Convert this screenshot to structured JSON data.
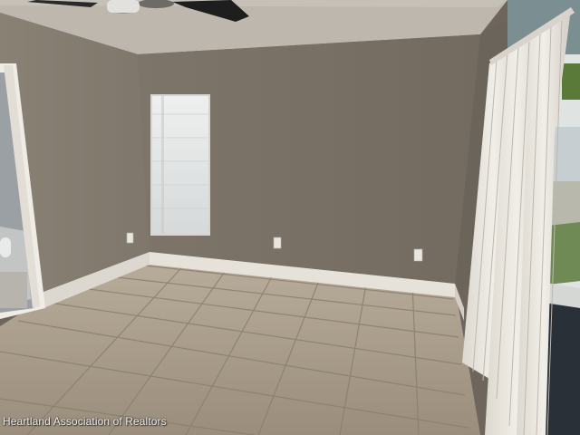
{
  "photo": {
    "subject": "empty-room",
    "watermark": "Heartland Association of Realtors"
  },
  "colors": {
    "wall_back": "#7a7166",
    "wall_left": "#857c70",
    "wall_right": "#6d675e",
    "ceiling": "#b9b3aa",
    "floor_tile": "#a99c8a",
    "grout": "#8c806f",
    "baseboard": "#e8e4dc",
    "window_glass": "#e4e6e6",
    "blinds": "#e9e6df",
    "door_frame": "#efece5"
  },
  "icons": [
    "ceiling-fan-icon",
    "outlet-icon"
  ]
}
